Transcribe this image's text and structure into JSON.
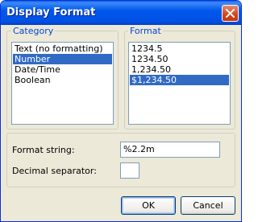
{
  "window": {
    "title": "Display Format"
  },
  "category": {
    "legend": "Category",
    "items": [
      "Text (no formatting)",
      "Number",
      "Date/Time",
      "Boolean"
    ],
    "selected": "Number"
  },
  "format": {
    "legend": "Format",
    "items": [
      "1234.5",
      "1234.50",
      "1,234.50",
      "$1,234.50"
    ],
    "selected": "$1,234.50"
  },
  "fields": {
    "format_string_label": "Format string:",
    "format_string_value": "%2.2m",
    "decimal_separator_label": "Decimal separator:",
    "decimal_separator_value": ""
  },
  "buttons": {
    "ok": "OK",
    "cancel": "Cancel"
  },
  "icons": {
    "close": "close-icon"
  },
  "colors": {
    "selection": "#316ac5",
    "legend_text": "#0046d5",
    "dialog_bg": "#ece9d8"
  }
}
